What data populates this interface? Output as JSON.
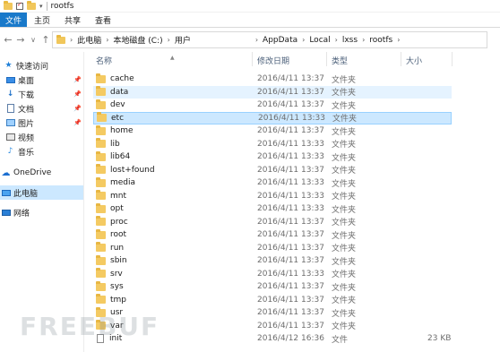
{
  "window": {
    "title": "rootfs"
  },
  "ribbon": {
    "tabs": [
      "文件",
      "主页",
      "共享",
      "查看"
    ]
  },
  "nav": {
    "back": "←",
    "forward": "→",
    "recent": "∨",
    "up": "↑"
  },
  "address": {
    "crumbs_left": [
      "此电脑",
      "本地磁盘 (C:)",
      "用户"
    ],
    "crumbs_right": [
      "AppData",
      "Local",
      "lxss",
      "rootfs"
    ],
    "separator": "›"
  },
  "sidebar": {
    "items": [
      {
        "label": "快速访问",
        "icon": "star-icon"
      },
      {
        "label": "桌面",
        "icon": "desktop-icon",
        "pinned": true
      },
      {
        "label": "下载",
        "icon": "download-icon",
        "pinned": true
      },
      {
        "label": "文档",
        "icon": "document-icon",
        "pinned": true
      },
      {
        "label": "图片",
        "icon": "picture-icon",
        "pinned": true
      },
      {
        "label": "视频",
        "icon": "video-icon"
      },
      {
        "label": "音乐",
        "icon": "music-icon"
      },
      {
        "label": "OneDrive",
        "icon": "cloud-icon"
      },
      {
        "label": "此电脑",
        "icon": "computer-icon",
        "selected": true
      },
      {
        "label": "网络",
        "icon": "network-icon"
      }
    ],
    "pin_glyph": "📌",
    "chevron": "›"
  },
  "columns": {
    "name": "名称",
    "date": "修改日期",
    "type": "类型",
    "size": "大小"
  },
  "files": [
    {
      "name": "cache",
      "date": "2016/4/11 13:37",
      "type": "文件夹",
      "size": ""
    },
    {
      "name": "data",
      "date": "2016/4/11 13:37",
      "type": "文件夹",
      "size": "",
      "state": "hover"
    },
    {
      "name": "dev",
      "date": "2016/4/11 13:37",
      "type": "文件夹",
      "size": ""
    },
    {
      "name": "etc",
      "date": "2016/4/11 13:33",
      "type": "文件夹",
      "size": "",
      "state": "selected"
    },
    {
      "name": "home",
      "date": "2016/4/11 13:37",
      "type": "文件夹",
      "size": ""
    },
    {
      "name": "lib",
      "date": "2016/4/11 13:33",
      "type": "文件夹",
      "size": ""
    },
    {
      "name": "lib64",
      "date": "2016/4/11 13:33",
      "type": "文件夹",
      "size": ""
    },
    {
      "name": "lost+found",
      "date": "2016/4/11 13:37",
      "type": "文件夹",
      "size": ""
    },
    {
      "name": "media",
      "date": "2016/4/11 13:33",
      "type": "文件夹",
      "size": ""
    },
    {
      "name": "mnt",
      "date": "2016/4/11 13:33",
      "type": "文件夹",
      "size": ""
    },
    {
      "name": "opt",
      "date": "2016/4/11 13:33",
      "type": "文件夹",
      "size": ""
    },
    {
      "name": "proc",
      "date": "2016/4/11 13:37",
      "type": "文件夹",
      "size": ""
    },
    {
      "name": "root",
      "date": "2016/4/11 13:37",
      "type": "文件夹",
      "size": ""
    },
    {
      "name": "run",
      "date": "2016/4/11 13:37",
      "type": "文件夹",
      "size": ""
    },
    {
      "name": "sbin",
      "date": "2016/4/11 13:37",
      "type": "文件夹",
      "size": ""
    },
    {
      "name": "srv",
      "date": "2016/4/11 13:33",
      "type": "文件夹",
      "size": ""
    },
    {
      "name": "sys",
      "date": "2016/4/11 13:37",
      "type": "文件夹",
      "size": ""
    },
    {
      "name": "tmp",
      "date": "2016/4/11 13:37",
      "type": "文件夹",
      "size": ""
    },
    {
      "name": "usr",
      "date": "2016/4/11 13:37",
      "type": "文件夹",
      "size": ""
    },
    {
      "name": "var",
      "date": "2016/4/11 13:37",
      "type": "文件夹",
      "size": ""
    },
    {
      "name": "init",
      "date": "2016/4/12 16:36",
      "type": "文件",
      "size": "23 KB",
      "kind": "file"
    }
  ],
  "watermark": "FREEBUF"
}
